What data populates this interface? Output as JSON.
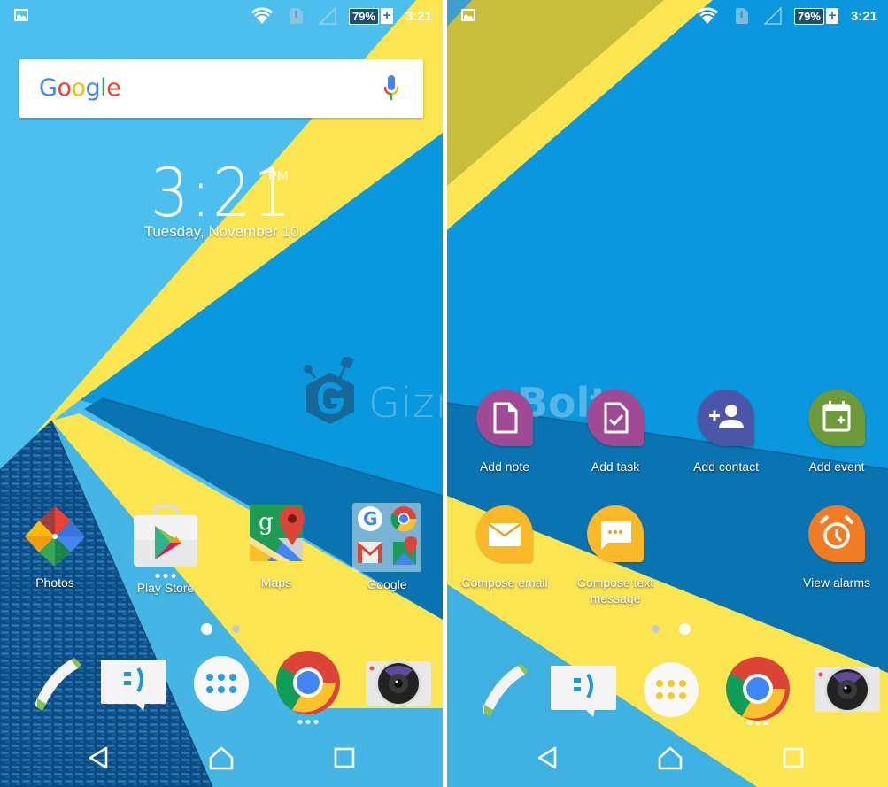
{
  "status_bar": {
    "notification_icon": "image-icon",
    "wifi_icon": "wifi-icon",
    "sim_icon": "sim-alert-icon",
    "signal_icon": "signal-empty-icon",
    "battery_percent": "79%",
    "battery_charging": "+",
    "time": "3:21"
  },
  "left_screen": {
    "search_widget": {
      "logo_letters": [
        {
          "char": "G",
          "color": "#4285F4"
        },
        {
          "char": "o",
          "color": "#EA4335"
        },
        {
          "char": "o",
          "color": "#FBBC05"
        },
        {
          "char": "g",
          "color": "#4285F4"
        },
        {
          "char": "l",
          "color": "#34A853"
        },
        {
          "char": "e",
          "color": "#EA4335"
        }
      ],
      "mic_icon": "microphone-icon"
    },
    "clock_widget": {
      "time": "3:21",
      "ampm": "PM",
      "date": "Tuesday, November 10"
    },
    "watermark": {
      "part1": "Gizmo",
      "part2": "Bolt"
    },
    "apps": [
      {
        "label": "Photos",
        "icon": "photos-icon"
      },
      {
        "label": "Play Store",
        "icon": "play-store-icon",
        "has_more": true
      },
      {
        "label": "Maps",
        "icon": "maps-icon"
      },
      {
        "label": "Google",
        "icon": "google-folder-icon"
      }
    ],
    "pager": {
      "pages": 2,
      "active_page": 1
    }
  },
  "right_screen": {
    "shortcuts": [
      {
        "label": "Add note",
        "icon": "note-icon",
        "color": "#a04a96"
      },
      {
        "label": "Add task",
        "icon": "task-icon",
        "color": "#a04a96"
      },
      {
        "label": "Add contact",
        "icon": "add-contact-icon",
        "color": "#4b56a8"
      },
      {
        "label": "Add event",
        "icon": "calendar-add-icon",
        "color": "#6f9a3a"
      },
      {
        "label": "Compose email",
        "icon": "email-icon",
        "color": "#fbb829"
      },
      {
        "label": "Compose text message",
        "icon": "message-icon",
        "color": "#fbb829"
      },
      {
        "label": "View alarms",
        "icon": "alarm-icon",
        "color": "#f27c23"
      }
    ],
    "pager": {
      "pages": 2,
      "active_page": 2
    }
  },
  "dock": [
    {
      "name": "Phone",
      "icon": "phone-icon"
    },
    {
      "name": "Messaging",
      "icon": "messaging-icon"
    },
    {
      "name": "App drawer",
      "icon": "app-drawer-icon"
    },
    {
      "name": "Chrome",
      "icon": "chrome-icon",
      "has_more": true
    },
    {
      "name": "Camera",
      "icon": "camera-icon"
    }
  ],
  "navigation": {
    "back": "back-icon",
    "home": "home-icon",
    "recents": "recents-icon"
  },
  "colors": {
    "sky_blue": "#4dbfee",
    "mid_blue": "#0a97de",
    "deep_blue": "#0a72b0",
    "yellow": "#fbe651",
    "carbon": "#0e4f86"
  }
}
